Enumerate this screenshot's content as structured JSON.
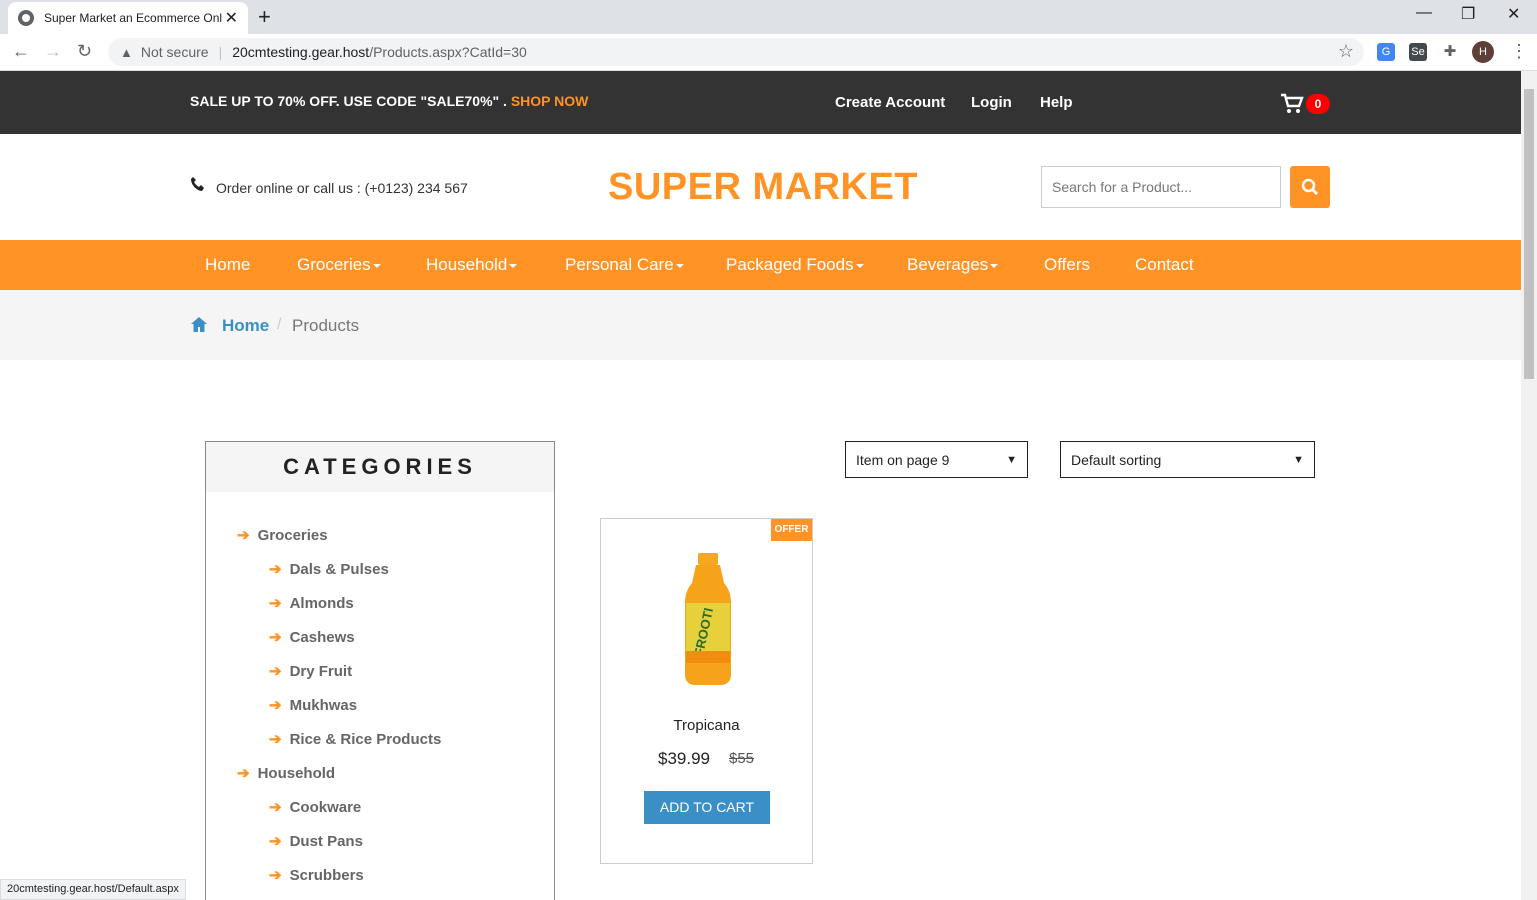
{
  "browser": {
    "tab_title": "Super Market an Ecommerce Onl",
    "new_tab": "+",
    "security_label": "Not secure",
    "url_host": "20cmtesting.gear.host",
    "url_path": "/Products.aspx?CatId=30",
    "avatar_letter": "H",
    "status_url": "20cmtesting.gear.host/Default.aspx"
  },
  "topbar": {
    "promo_text": "SALE UP TO 70% OFF. USE CODE \"SALE70%\" .",
    "shop_now": "SHOP NOW",
    "links": [
      "Create Account",
      "Login",
      "Help"
    ],
    "cart_count": "0"
  },
  "header": {
    "phone_text": "Order online or call us : (+0123) 234 567",
    "logo": "SUPER MARKET",
    "search_placeholder": "Search for a Product..."
  },
  "nav": {
    "items": [
      {
        "label": "Home",
        "dropdown": false
      },
      {
        "label": "Groceries",
        "dropdown": true
      },
      {
        "label": "Household",
        "dropdown": true
      },
      {
        "label": "Personal Care",
        "dropdown": true
      },
      {
        "label": "Packaged Foods",
        "dropdown": true
      },
      {
        "label": "Beverages",
        "dropdown": true
      },
      {
        "label": "Offers",
        "dropdown": false
      },
      {
        "label": "Contact",
        "dropdown": false
      }
    ]
  },
  "breadcrumb": {
    "home": "Home",
    "separator": "/",
    "current": "Products"
  },
  "categories": {
    "title": "CATEGORIES",
    "items": [
      {
        "label": "Groceries",
        "level": 1
      },
      {
        "label": "Dals & Pulses",
        "level": 2
      },
      {
        "label": "Almonds",
        "level": 2
      },
      {
        "label": "Cashews",
        "level": 2
      },
      {
        "label": "Dry Fruit",
        "level": 2
      },
      {
        "label": "Mukhwas",
        "level": 2
      },
      {
        "label": "Rice & Rice Products",
        "level": 2
      },
      {
        "label": "Household",
        "level": 1
      },
      {
        "label": "Cookware",
        "level": 2
      },
      {
        "label": "Dust Pans",
        "level": 2
      },
      {
        "label": "Scrubbers",
        "level": 2
      }
    ]
  },
  "filters": {
    "items_per_page": "Item on page 9",
    "sorting": "Default sorting"
  },
  "products": [
    {
      "name": "Tropicana",
      "price": "$39.99",
      "old_price": "$55",
      "badge": "OFFER",
      "bottle_label": "FROOTI",
      "button": "ADD TO CART"
    }
  ],
  "colors": {
    "accent": "#ff9326",
    "dark": "#333333",
    "link": "#3b8fc7",
    "badge_red": "#ff0000"
  }
}
